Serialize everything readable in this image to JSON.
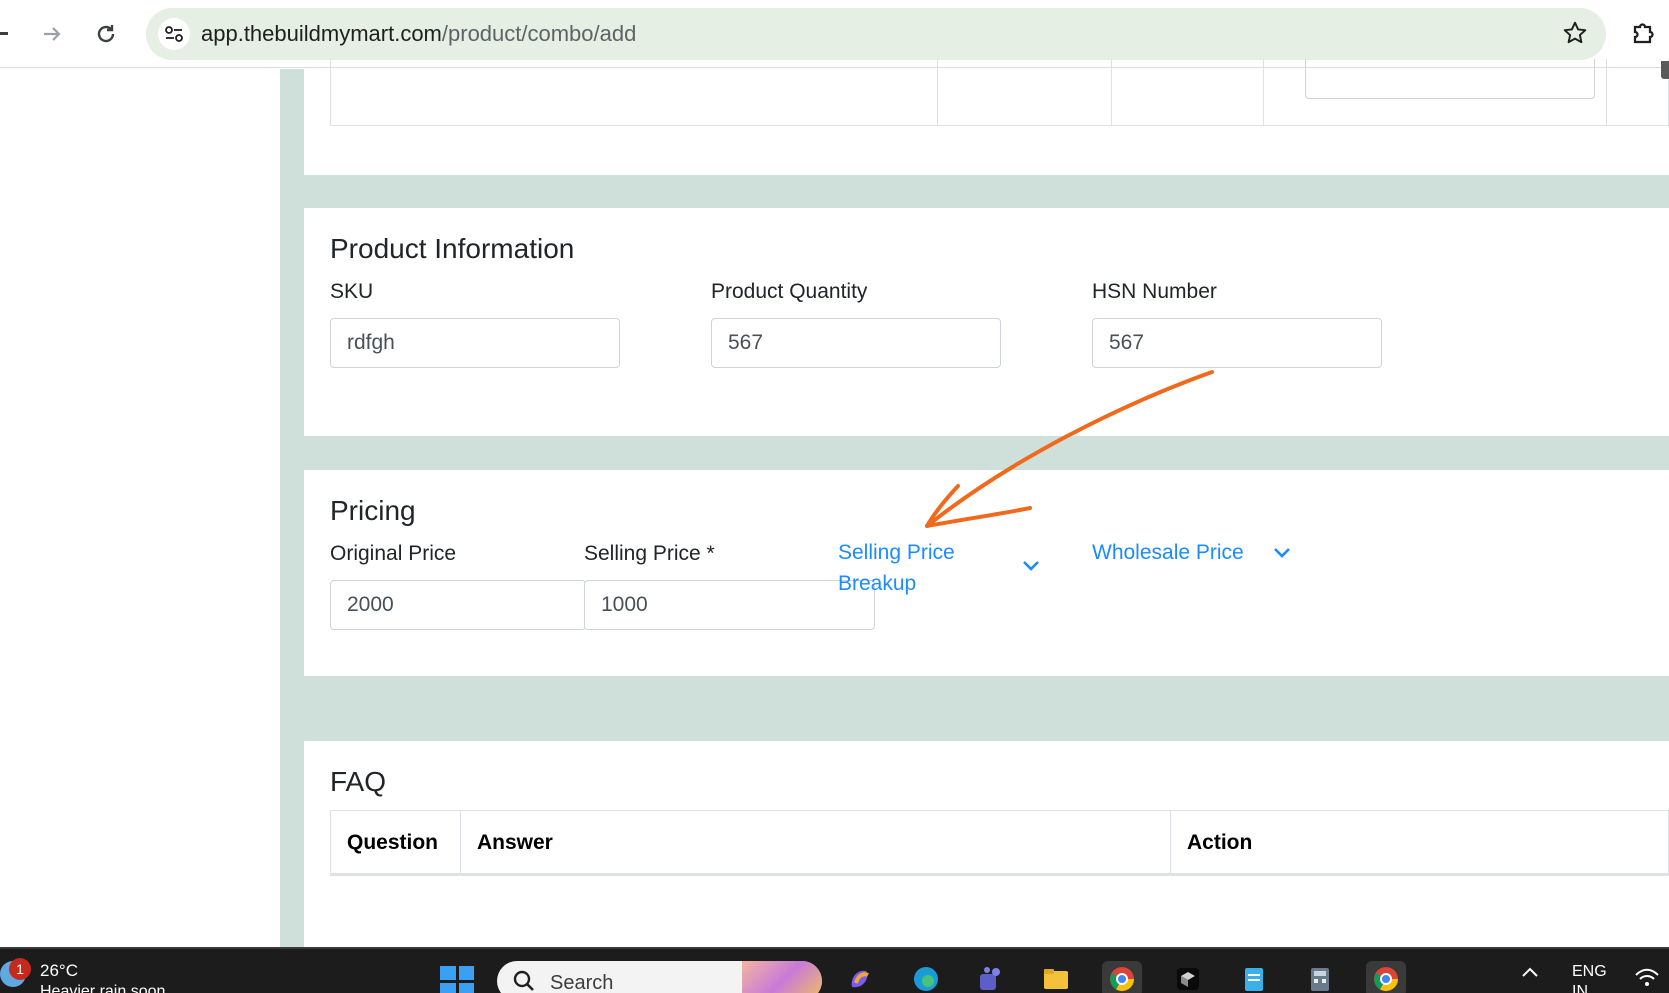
{
  "browser": {
    "url_host": "app.thebuildmymart.com",
    "url_path": "/product/combo/add"
  },
  "product_information": {
    "title": "Product Information",
    "sku": {
      "label": "SKU",
      "value": "rdfgh"
    },
    "quantity": {
      "label": "Product Quantity",
      "value": "567"
    },
    "hsn": {
      "label": "HSN Number",
      "value": "567"
    }
  },
  "pricing": {
    "title": "Pricing",
    "original_price": {
      "label": "Original Price",
      "value": "2000"
    },
    "selling_price": {
      "label": "Selling Price *",
      "value": "1000"
    },
    "selling_price_breakup": "Selling Price Breakup",
    "wholesale_price": "Wholesale Price"
  },
  "faq": {
    "title": "FAQ",
    "columns": [
      "Question",
      "Answer",
      "Action"
    ]
  },
  "taskbar": {
    "weather_badge": "1",
    "weather_temp": "26°C",
    "weather_desc": "Heavier rain soon",
    "search_placeholder": "Search",
    "lang_line1": "ENG",
    "lang_line2": "IN"
  },
  "colors": {
    "accent_link": "#1a8cff",
    "page_background": "#cfe0da",
    "annotation_arrow": "#f06a1d"
  }
}
